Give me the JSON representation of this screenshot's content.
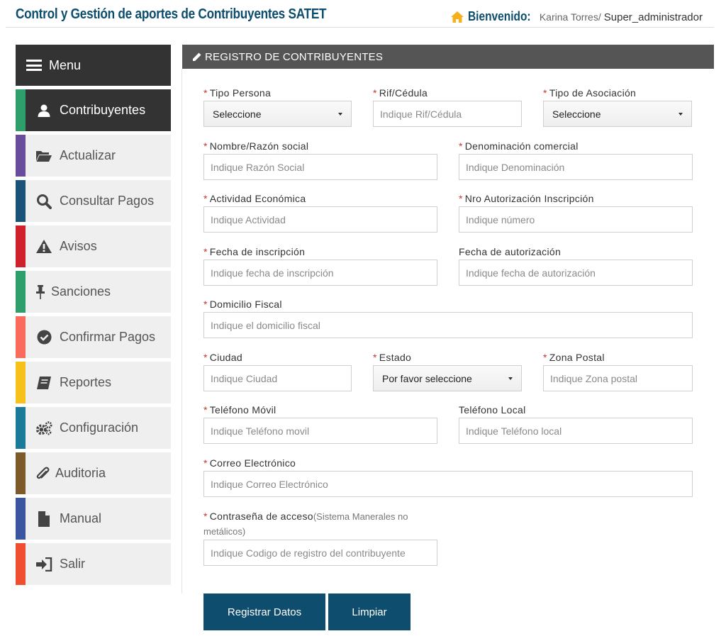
{
  "header": {
    "title": "Control y Gestión de aportes de Contribuyentes SATET",
    "welcome_label": "Bienvenido:",
    "user_name": "Karina Torres/",
    "user_role": "Super_administrador"
  },
  "sidebar": {
    "menu_label": "Menu",
    "items": [
      {
        "label": "Contribuyentes",
        "icon": "user-icon",
        "color": "#2e9e6a"
      },
      {
        "label": "Actualizar",
        "icon": "folder-open-icon",
        "color": "#6a4c9c"
      },
      {
        "label": "Consultar Pagos",
        "icon": "search-icon",
        "color": "#1a5278"
      },
      {
        "label": "Avisos",
        "icon": "warning-icon",
        "color": "#d0202b"
      },
      {
        "label": "Sanciones",
        "icon": "pushpin-icon",
        "color": "#2e9e6a"
      },
      {
        "label": "Confirmar Pagos",
        "icon": "check-circle-icon",
        "color": "#fb6b5b"
      },
      {
        "label": "Reportes",
        "icon": "book-icon",
        "color": "#f7c11c"
      },
      {
        "label": "Configuración",
        "icon": "gears-icon",
        "color": "#1a7a9a"
      },
      {
        "label": "Auditoria",
        "icon": "paperclip-icon",
        "color": "#7d5a2a"
      },
      {
        "label": "Manual",
        "icon": "file-icon",
        "color": "#3a56a0"
      },
      {
        "label": "Salir",
        "icon": "sign-in-icon",
        "color": "#f04e30"
      }
    ]
  },
  "panel": {
    "title": "REGISTRO DE CONTRIBUYENTES"
  },
  "form": {
    "tipo_persona": {
      "label": "Tipo Persona",
      "value": "Seleccione"
    },
    "rif": {
      "label": "Rif/Cédula",
      "placeholder": "Indique Rif/Cédula"
    },
    "tipo_asociacion": {
      "label": "Tipo de Asociación",
      "value": "Seleccione"
    },
    "nombre": {
      "label": "Nombre/Razón social",
      "placeholder": "Indique Razón Social"
    },
    "denominacion": {
      "label": "Denominación comercial",
      "placeholder": "Indique Denominación"
    },
    "actividad": {
      "label": "Actividad Económica",
      "placeholder": "Indique Actividad"
    },
    "nro_autorizacion": {
      "label": "Nro Autorización Inscripción",
      "placeholder": "Indique número"
    },
    "fecha_inscripcion": {
      "label": "Fecha de inscripción",
      "placeholder": "Indique fecha de inscripción"
    },
    "fecha_autorizacion": {
      "label": "Fecha de autorización",
      "placeholder": "Indique fecha de autorización"
    },
    "domicilio": {
      "label": "Domicilio Fiscal",
      "placeholder": "Indique el domicilio fiscal"
    },
    "ciudad": {
      "label": "Ciudad",
      "placeholder": "Indique Ciudad"
    },
    "estado": {
      "label": "Estado",
      "value": "Por favor seleccione"
    },
    "zona_postal": {
      "label": "Zona Postal",
      "placeholder": "Indique Zona postal"
    },
    "telefono_movil": {
      "label": "Teléfono Móvil",
      "placeholder": "Indique Teléfono movil"
    },
    "telefono_local": {
      "label": "Teléfono Local",
      "placeholder": "Indique Teléfono local"
    },
    "correo": {
      "label": "Correo Electrónico",
      "placeholder": "Indique Correo Electrónico"
    },
    "contrasena": {
      "label": "Contraseña de acceso",
      "hint": "(Sistema Manerales no metálicos)",
      "placeholder": "Indique Codigo de registro del contribuyente"
    }
  },
  "buttons": {
    "register": "Registrar Datos",
    "clear": "Limpiar"
  },
  "colors": {
    "brand": "#0c4d6e",
    "sidebar_dark": "#333333",
    "panel_header": "#555555",
    "button": "#0e4d6d",
    "required": "#c0392b",
    "home_icon": "#f5b01a"
  }
}
